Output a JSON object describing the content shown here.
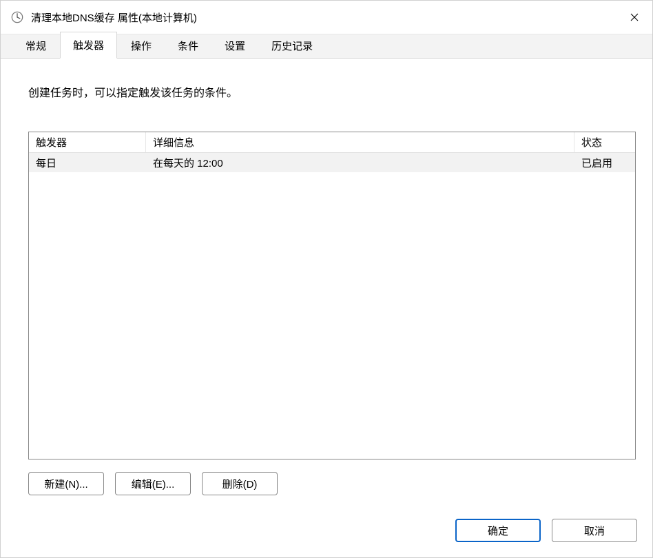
{
  "window": {
    "title": "清理本地DNS缓存 属性(本地计算机)"
  },
  "tabs": {
    "items": [
      {
        "label": "常规"
      },
      {
        "label": "触发器"
      },
      {
        "label": "操作"
      },
      {
        "label": "条件"
      },
      {
        "label": "设置"
      },
      {
        "label": "历史记录"
      }
    ],
    "activeIndex": 1
  },
  "triggersTab": {
    "description": "创建任务时，可以指定触发该任务的条件。",
    "columns": {
      "trigger": "触发器",
      "detail": "详细信息",
      "status": "状态"
    },
    "rows": [
      {
        "trigger": "每日",
        "detail": "在每天的 12:00",
        "status": "已启用"
      }
    ],
    "buttons": {
      "new": "新建(N)...",
      "edit": "编辑(E)...",
      "delete": "删除(D)"
    }
  },
  "dialogButtons": {
    "ok": "确定",
    "cancel": "取消"
  }
}
